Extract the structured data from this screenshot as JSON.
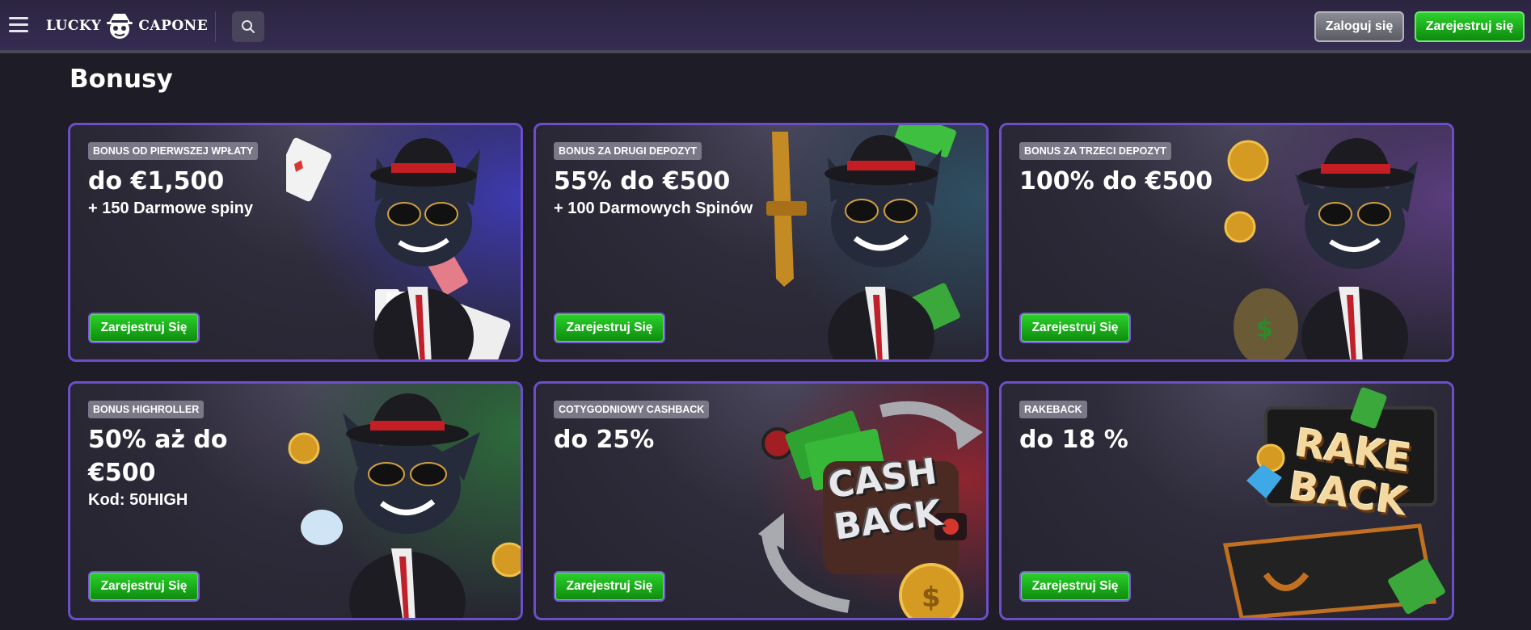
{
  "header": {
    "logo_left": "LUCKY",
    "logo_right": "CAPONE",
    "login_label": "Zaloguj się",
    "register_label": "Zarejestruj się"
  },
  "page": {
    "title": "Bonusy"
  },
  "cards": [
    {
      "badge": "Bonus od pierwszej wpłaty",
      "headline": "do €1,500",
      "subtitle": "+ 150 Darmowe spiny",
      "button": "Zarejestruj Się"
    },
    {
      "badge": "Bonus za drugi depozyt",
      "headline": "55% do €500",
      "subtitle": "+ 100 Darmowych Spinów",
      "button": "Zarejestruj Się"
    },
    {
      "badge": "Bonus za trzeci depozyt",
      "headline": "100% do €500",
      "subtitle": "",
      "button": "Zarejestruj Się"
    },
    {
      "badge": "Bonus Highroller",
      "headline": "50% aż do €500",
      "subtitle": "Kod: 50HIGH",
      "button": "Zarejestruj Się"
    },
    {
      "badge": "Cotygodniowy Cashback",
      "headline": "do 25%",
      "subtitle": "",
      "button": "Zarejestruj Się",
      "art_text_1": "CASH",
      "art_text_2": "BACK"
    },
    {
      "badge": "Rakeback",
      "headline": "do 18 %",
      "subtitle": "",
      "button": "Zarejestruj Się",
      "art_text_1": "RAKE",
      "art_text_2": "BACK"
    }
  ],
  "colors": {
    "accent_green": "#1fb31f",
    "card_border": "#6c4fc8",
    "header_bg": "#2f2846",
    "page_bg": "#1e1c26"
  },
  "icons": {
    "menu": "hamburger-icon",
    "search": "search-icon",
    "logo": "gangster-cat-logo"
  }
}
